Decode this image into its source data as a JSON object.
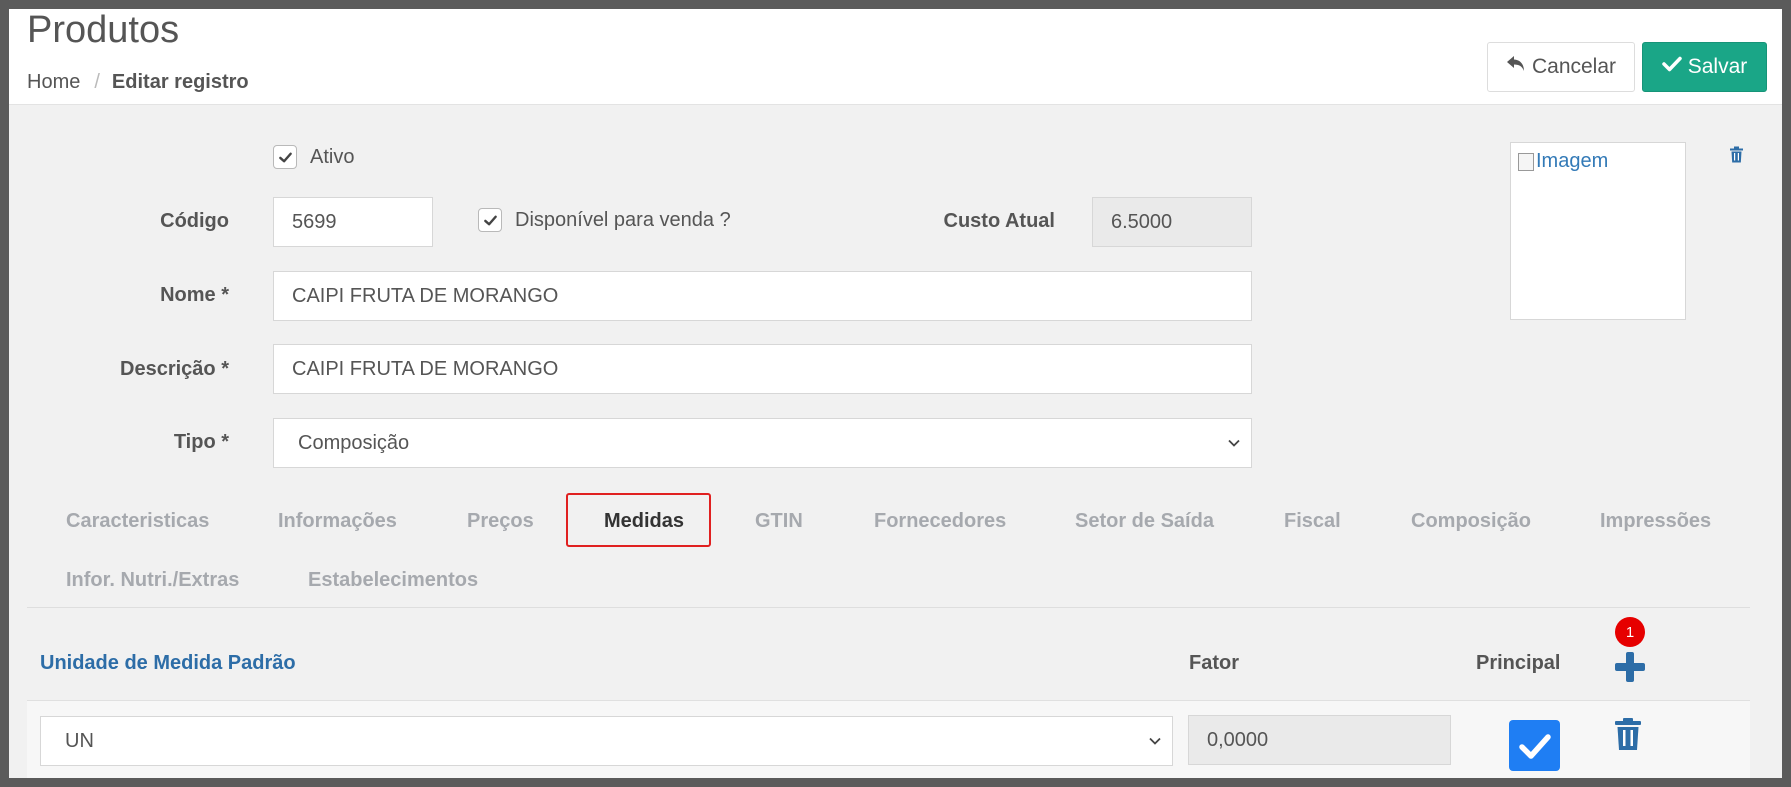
{
  "header": {
    "title": "Produtos",
    "breadcrumb": {
      "home": "Home",
      "separator": "/",
      "current": "Editar registro"
    },
    "cancel_label": "Cancelar",
    "save_label": "Salvar"
  },
  "form": {
    "ativo": {
      "label": "Ativo",
      "checked": true
    },
    "codigo": {
      "label": "Código",
      "value": "5699"
    },
    "disponivel": {
      "label": "Disponível para venda ?",
      "checked": true
    },
    "custo": {
      "label": "Custo Atual",
      "value": "6.5000"
    },
    "nome": {
      "label": "Nome *",
      "value": "CAIPI FRUTA DE MORANGO"
    },
    "descricao": {
      "label": "Descrição *",
      "value": "CAIPI FRUTA DE MORANGO"
    },
    "tipo": {
      "label": "Tipo *",
      "value": "Composição"
    },
    "image_alt": "Imagem"
  },
  "tabs": [
    {
      "label": "Caracteristicas"
    },
    {
      "label": "Informações"
    },
    {
      "label": "Preços"
    },
    {
      "label": "Medidas",
      "active": true
    },
    {
      "label": "GTIN"
    },
    {
      "label": "Fornecedores"
    },
    {
      "label": "Setor de Saída"
    },
    {
      "label": "Fiscal"
    },
    {
      "label": "Composição"
    },
    {
      "label": "Impressões"
    },
    {
      "label": "Infor. Nutri./Extras"
    },
    {
      "label": "Estabelecimentos"
    }
  ],
  "medidas": {
    "headers": {
      "unidade": "Unidade de Medida Padrão",
      "fator": "Fator",
      "principal": "Principal"
    },
    "badge": "1",
    "rows": [
      {
        "unidade": "UN",
        "fator": "0,0000",
        "principal": true
      }
    ]
  },
  "colors": {
    "accent_save": "#1aa687",
    "link": "#2d6da7",
    "badge": "#e60000",
    "checkbox": "#1f7ef3",
    "highlight_box": "#e02020"
  }
}
